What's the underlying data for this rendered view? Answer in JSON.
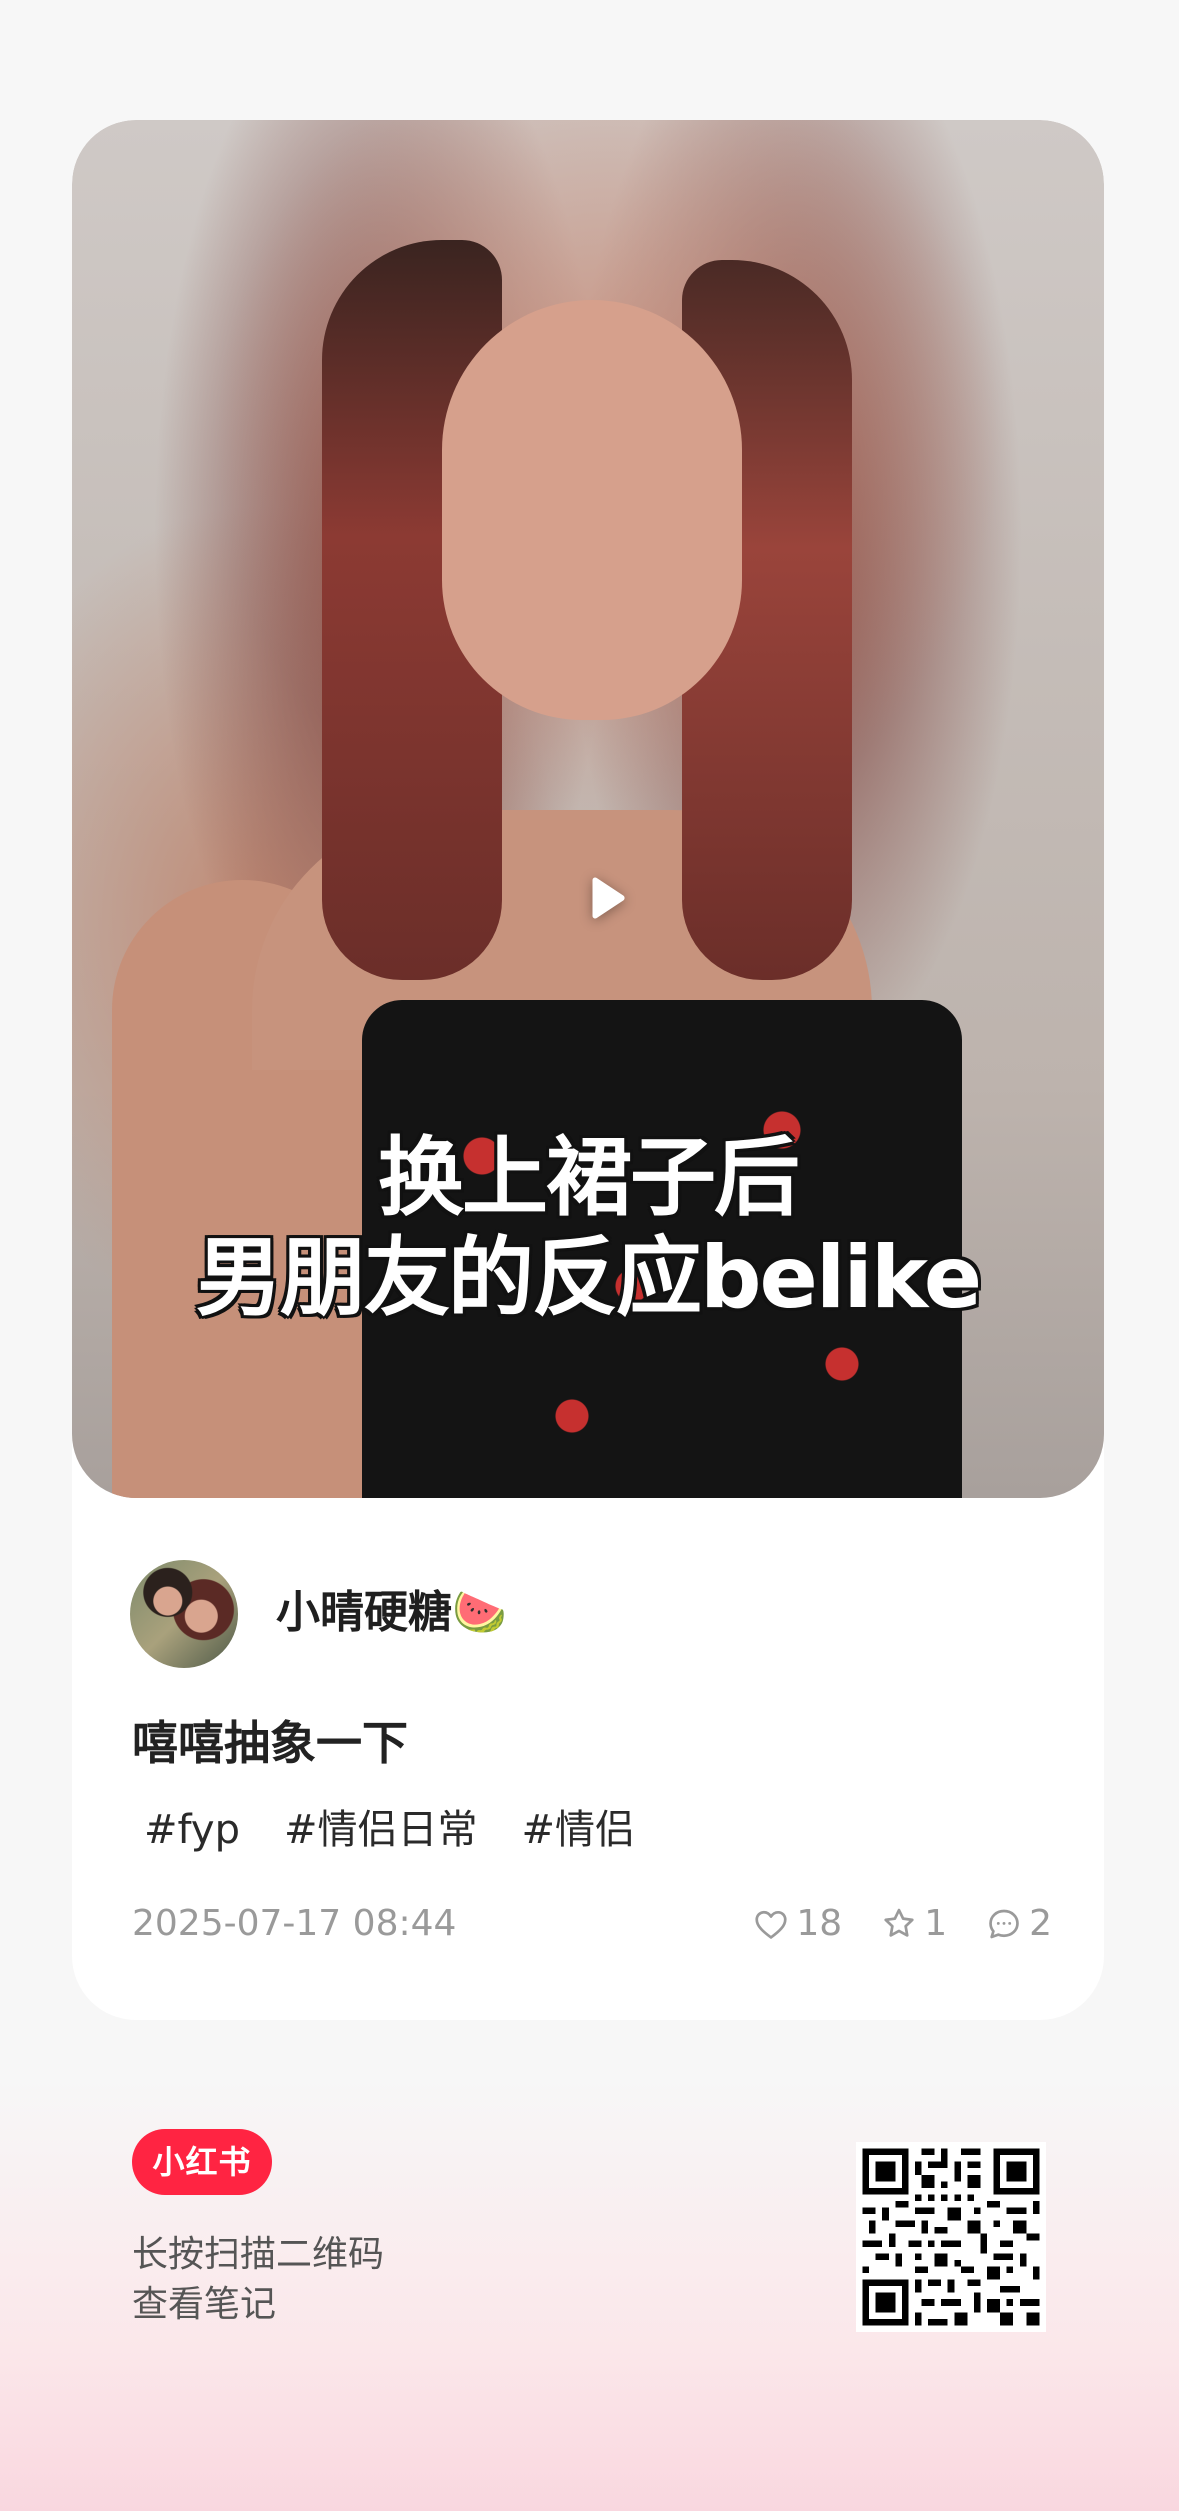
{
  "note": {
    "cover": {
      "caption_line1": "换上裙子后",
      "caption_line2": "男朋友的反应belike"
    },
    "author": {
      "name": "小晴硬糖🍉"
    },
    "title": "嘻嘻抽象一下",
    "tags": [
      "#fyp",
      "#情侣日常",
      "#情侣"
    ],
    "date": "2025-07-17 08:44",
    "stats": {
      "likes": "18",
      "favorites": "1",
      "comments": "2"
    }
  },
  "footer": {
    "brand": "小红书",
    "hint_line1": "长按扫描二维码",
    "hint_line2": "查看笔记"
  },
  "colors": {
    "brand": "#ff2442",
    "muted_text": "#9a9a9a"
  },
  "icons": [
    "play-icon",
    "heart-icon",
    "star-icon",
    "comment-icon",
    "qr-code"
  ]
}
